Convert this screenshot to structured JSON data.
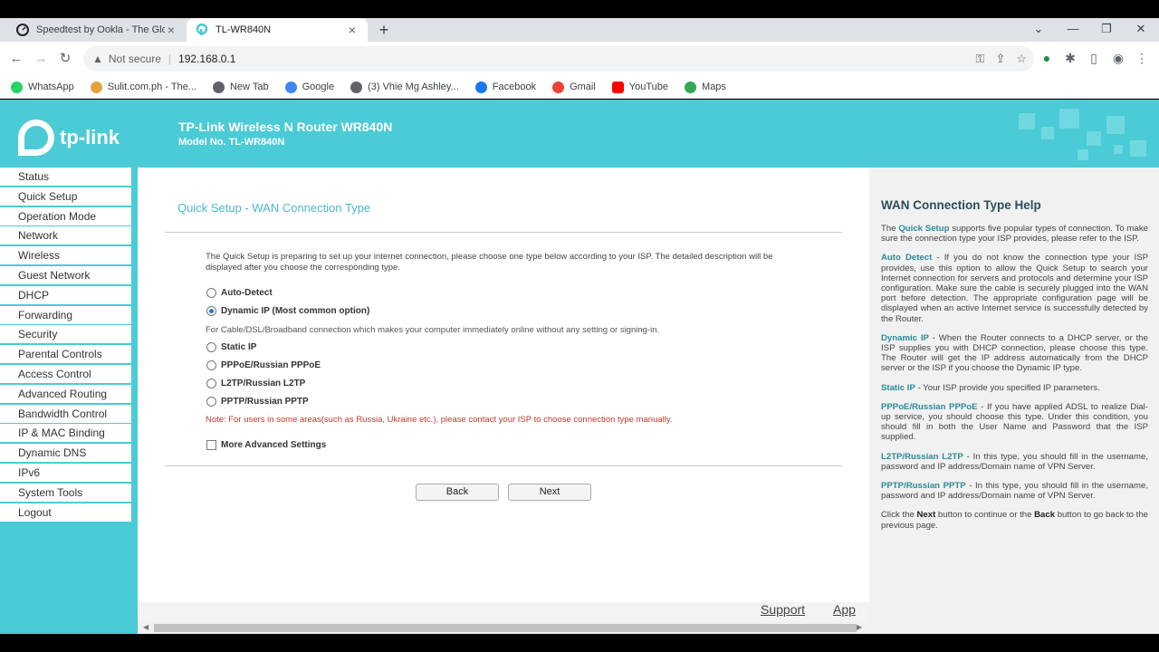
{
  "browser": {
    "tabs": [
      {
        "title": "Speedtest by Ookla - The Global",
        "active": false
      },
      {
        "title": "TL-WR840N",
        "active": true
      }
    ],
    "omnibox": {
      "security": "Not secure",
      "url": "192.168.0.1"
    },
    "bookmarks": [
      {
        "label": "WhatsApp",
        "color": "#25d366"
      },
      {
        "label": "Sulit.com.ph - The...",
        "color": "#e3a33b"
      },
      {
        "label": "New Tab",
        "color": "#5f6368"
      },
      {
        "label": "Google",
        "color": "#4285f4"
      },
      {
        "label": "(3) Vhie Mg Ashley...",
        "color": "#5f6368"
      },
      {
        "label": "Facebook",
        "color": "#1877f2"
      },
      {
        "label": "Gmail",
        "color": "#ea4335"
      },
      {
        "label": "YouTube",
        "color": "#ff0000"
      },
      {
        "label": "Maps",
        "color": "#34a853"
      }
    ]
  },
  "header": {
    "logo_text": "tp-link",
    "product_title": "TP-Link Wireless N Router WR840N",
    "model": "Model No. TL-WR840N"
  },
  "sidebar": {
    "items": [
      "Status",
      "Quick Setup",
      "Operation Mode",
      "Network",
      "Wireless",
      "Guest Network",
      "DHCP",
      "Forwarding",
      "Security",
      "Parental Controls",
      "Access Control",
      "Advanced Routing",
      "Bandwidth Control",
      "IP & MAC Binding",
      "Dynamic DNS",
      "IPv6",
      "System Tools",
      "Logout"
    ]
  },
  "main": {
    "title": "Quick Setup - WAN Connection Type",
    "description": "The Quick Setup is preparing to set up your internet connection, please choose one type below according to your ISP. The detailed description will be displayed after you choose the corresponding type.",
    "options": [
      {
        "label": "Auto-Detect",
        "selected": false
      },
      {
        "label": "Dynamic IP (Most common option)",
        "selected": true
      },
      {
        "label": "Static IP",
        "selected": false
      },
      {
        "label": "PPPoE/Russian PPPoE",
        "selected": false
      },
      {
        "label": "L2TP/Russian L2TP",
        "selected": false
      },
      {
        "label": "PPTP/Russian PPTP",
        "selected": false
      }
    ],
    "dynamic_note": "For Cable/DSL/Broadband connection which makes your computer immediately online without any setting or signing-in.",
    "warning_note": "Note: For users in some areas(such as Russia, Ukraine etc.), please contact your ISP to choose connection type manually.",
    "advanced_label": "More Advanced Settings",
    "back_label": "Back",
    "next_label": "Next"
  },
  "footer": {
    "support": "Support",
    "app": "App"
  },
  "help": {
    "title": "WAN Connection Type Help",
    "p1_pre": "The ",
    "p1_key": "Quick Setup",
    "p1_post": " supports five popular types of connection. To make sure the connection type your ISP provides, please refer to the ISP.",
    "p2_key": "Auto Detect",
    "p2_post": " - If you do not know the connection type your ISP provides, use this option to allow the Quick Setup to search your Internet connection for servers and protocols and determine your ISP configuration. Make sure the cable is securely plugged into the WAN port before detection. The appropriate configuration page will be displayed when an active Internet service is successfully detected by the Router.",
    "p3_key": "Dynamic IP",
    "p3_post": " - When the Router connects to a DHCP server, or the ISP supplies you with DHCP connection, please choose this type. The Router will get the IP address automatically from the DHCP server or the ISP if you choose the Dynamic IP type.",
    "p4_key": "Static IP",
    "p4_post": " - Your ISP provide you specified IP parameters.",
    "p5_key": "PPPoE/Russian PPPoE",
    "p5_post": " - If you have applied ADSL to realize Dial-up service, you should choose this type. Under this condition, you should fill in both the User Name and Password that the ISP supplied.",
    "p6_key": "L2TP/Russian L2TP",
    "p6_post": " - In this type, you should fill in the username, password and IP address/Domain name of VPN Server.",
    "p7_key": "PPTP/Russian PPTP",
    "p7_post": " - In this type, you should fill in the username, password and IP address/Domain name of VPN Server.",
    "p8_pre": "Click the ",
    "p8_next": "Next",
    "p8_mid": " button to continue or the ",
    "p8_back": "Back",
    "p8_post": " button to go back to the previous page."
  }
}
